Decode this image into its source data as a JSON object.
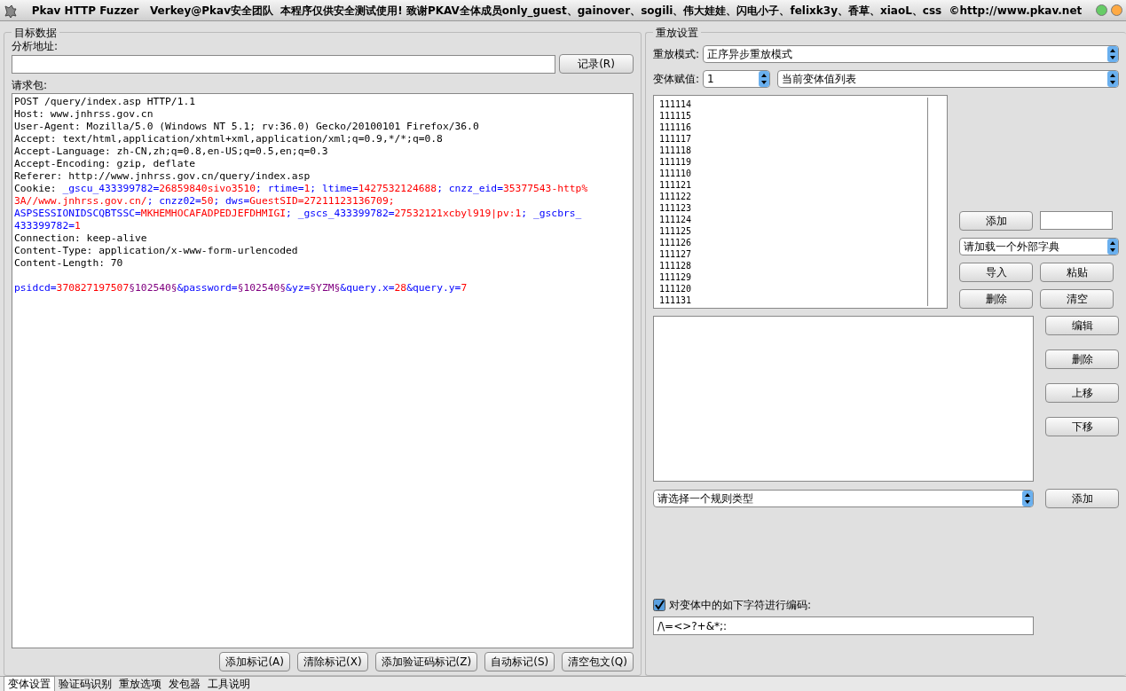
{
  "window": {
    "title": "Pkav HTTP Fuzzer   Verkey@Pkav安全团队  本程序仅供安全测试使用! 致谢PKAV全体成员only_guest、gainover、sogili、伟大娃娃、闪电小子、felixk3y、香草、xiaoL、css  ©http://www.pkav.net"
  },
  "target": {
    "legend": "目标数据",
    "address_label": "分析地址:",
    "record_button": "记录(R)",
    "request_label": "请求包:",
    "request_lines": [
      {
        "segments": [
          {
            "text": "POST /query/index.asp HTTP/1.1",
            "color": "#000000"
          }
        ]
      },
      {
        "segments": [
          {
            "text": "Host: www.jnhrss.gov.cn",
            "color": "#000000"
          }
        ]
      },
      {
        "segments": [
          {
            "text": "User-Agent: Mozilla/5.0 (Windows NT 5.1; rv:36.0) Gecko/20100101 Firefox/36.0",
            "color": "#000000"
          }
        ]
      },
      {
        "segments": [
          {
            "text": "Accept: text/html,application/xhtml+xml,application/xml;q=0.9,*/*;q=0.8",
            "color": "#000000"
          }
        ]
      },
      {
        "segments": [
          {
            "text": "Accept-Language: zh-CN,zh;q=0.8,en-US;q=0.5,en;q=0.3",
            "color": "#000000"
          }
        ]
      },
      {
        "segments": [
          {
            "text": "Accept-Encoding: gzip, deflate",
            "color": "#000000"
          }
        ]
      },
      {
        "segments": [
          {
            "text": "Referer: http://www.jnhrss.gov.cn/query/index.asp",
            "color": "#000000"
          }
        ]
      },
      {
        "segments": [
          {
            "text": "Cookie: ",
            "color": "#000000"
          },
          {
            "text": "_gscu_433399782=",
            "color": "#0000ff"
          },
          {
            "text": "26859840sivo3510",
            "color": "#ff0000"
          },
          {
            "text": "; rtime=",
            "color": "#0000ff"
          },
          {
            "text": "1",
            "color": "#ff0000"
          },
          {
            "text": "; ltime=",
            "color": "#0000ff"
          },
          {
            "text": "1427532124688",
            "color": "#ff0000"
          },
          {
            "text": "; cnzz_eid=",
            "color": "#0000ff"
          },
          {
            "text": "35377543-http%",
            "color": "#ff0000"
          }
        ]
      },
      {
        "segments": [
          {
            "text": "3A//www.jnhrss.gov.cn/",
            "color": "#ff0000"
          },
          {
            "text": "; cnzz02=",
            "color": "#0000ff"
          },
          {
            "text": "50",
            "color": "#ff0000"
          },
          {
            "text": "; dws=",
            "color": "#0000ff"
          },
          {
            "text": "GuestSID=27211123136709;",
            "color": "#ff0000"
          }
        ]
      },
      {
        "segments": [
          {
            "text": "ASPSESSIONIDSCQBTSSC=",
            "color": "#0000ff"
          },
          {
            "text": "MKHEMHOCAFADPEDJEFDHMIGI",
            "color": "#ff0000"
          },
          {
            "text": "; _gscs_433399782=",
            "color": "#0000ff"
          },
          {
            "text": "27532121xcbyl919|pv:1",
            "color": "#ff0000"
          },
          {
            "text": "; _gscbrs_",
            "color": "#0000ff"
          }
        ]
      },
      {
        "segments": [
          {
            "text": "433399782=",
            "color": "#0000ff"
          },
          {
            "text": "1",
            "color": "#ff0000"
          }
        ]
      },
      {
        "segments": [
          {
            "text": "Connection: keep-alive",
            "color": "#000000"
          }
        ]
      },
      {
        "segments": [
          {
            "text": "Content-Type: application/x-www-form-urlencoded",
            "color": "#000000"
          }
        ]
      },
      {
        "segments": [
          {
            "text": "Content-Length: 70",
            "color": "#000000"
          }
        ]
      }
    ],
    "request_body": {
      "segments": [
        {
          "text": "psidcd=",
          "color": "#0000ff"
        },
        {
          "text": "370827197507",
          "color": "#ff0000"
        },
        {
          "text": "§102540§",
          "color": "#800080"
        },
        {
          "text": "&password=",
          "color": "#0000ff"
        },
        {
          "text": "§102540§",
          "color": "#800080"
        },
        {
          "text": "&yz=",
          "color": "#0000ff"
        },
        {
          "text": "§YZM§",
          "color": "#800080"
        },
        {
          "text": "&query.x=",
          "color": "#0000ff"
        },
        {
          "text": "28",
          "color": "#ff0000"
        },
        {
          "text": "&query.y=",
          "color": "#0000ff"
        },
        {
          "text": "7",
          "color": "#ff0000"
        }
      ]
    },
    "buttons": [
      "添加标记(A)",
      "清除标记(X)",
      "添加验证码标记(Z)",
      "自动标记(S)",
      "清空包文(Q)"
    ]
  },
  "replay": {
    "legend": "重放设置",
    "mode_label": "重放模式:",
    "mode_value": "正序异步重放模式",
    "variant_label": "变体赋值:",
    "variant_value": "1",
    "variant_source": "当前变体值列表",
    "values": [
      "111114",
      "111115",
      "111116",
      "111117",
      "111118",
      "111119",
      "111110",
      "111121",
      "111122",
      "111123",
      "111124",
      "111125",
      "111126",
      "111127",
      "111128",
      "111129",
      "111120",
      "111131"
    ],
    "add_button": "添加",
    "dictionary_select": "请加载一个外部字典",
    "list_buttons": [
      "导入",
      "粘贴",
      "删除",
      "清空"
    ],
    "rule_buttons": [
      "编辑",
      "删除",
      "上移",
      "下移"
    ],
    "rule_type_select": "请选择一个规则类型",
    "rule_add_button": "添加",
    "encode": {
      "checked": true,
      "label": "对变体中的如下字符进行编码:",
      "value": "/\\=<>?+&*;:"
    }
  },
  "tabs": [
    {
      "label": "变体设置",
      "selected": true
    },
    {
      "label": "验证码识别",
      "selected": false
    },
    {
      "label": "重放选项",
      "selected": false
    },
    {
      "label": "发包器",
      "selected": false
    },
    {
      "label": "工具说明",
      "selected": false
    }
  ]
}
